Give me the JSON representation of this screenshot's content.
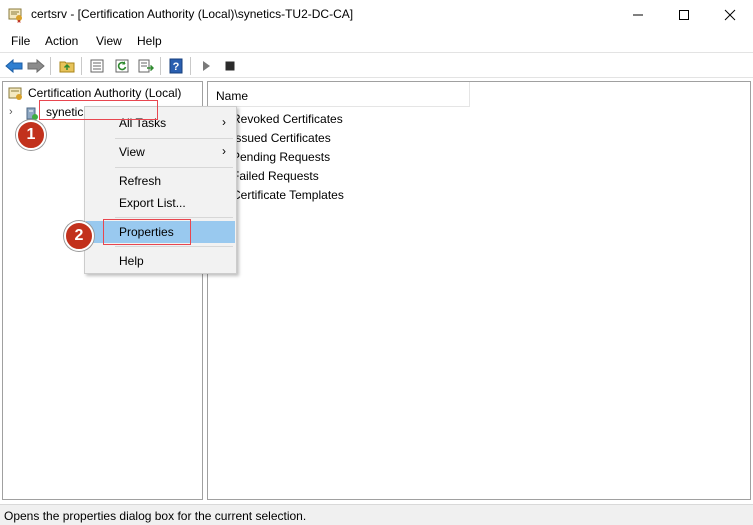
{
  "window": {
    "title": "certsrv - [Certification Authority (Local)\\synetics-TU2-DC-CA]",
    "minimize": "—",
    "maximize": "☐",
    "close": "✕"
  },
  "menubar": {
    "items": [
      "File",
      "Action",
      "View",
      "Help"
    ]
  },
  "tree": {
    "root": "Certification Authority (Local)",
    "child": "synetics-TU2-DC-CA",
    "child_prefix": "synetic",
    "child_suffix": "TU2-DC-CA"
  },
  "list": {
    "column": "Name",
    "rows": [
      "Revoked Certificates",
      "Issued Certificates",
      "Pending Requests",
      "Failed Requests",
      "Certificate Templates"
    ]
  },
  "context_menu": {
    "items": [
      {
        "label": "All Tasks",
        "submenu": true
      },
      {
        "label": "View",
        "submenu": true
      },
      {
        "label": "Refresh",
        "submenu": false
      },
      {
        "label": "Export List...",
        "submenu": false
      },
      {
        "label": "Properties",
        "submenu": false,
        "highlighted": true
      },
      {
        "label": "Help",
        "submenu": false
      }
    ],
    "arrow": "›"
  },
  "annotations": {
    "step1": "1",
    "step2": "2"
  },
  "status": {
    "text": "Opens the properties dialog box for the current selection."
  },
  "colors": {
    "highlight": "#99c9ef",
    "callout": "#c2311c",
    "redbox": "#e8464f"
  }
}
